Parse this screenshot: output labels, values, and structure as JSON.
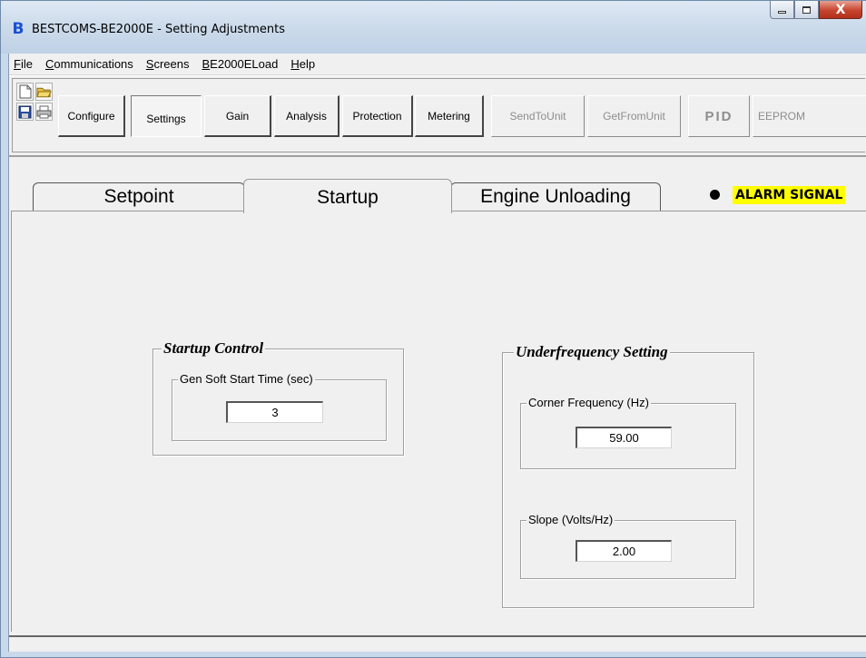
{
  "window": {
    "title": "BESTCOMS-BE2000E - Setting Adjustments",
    "app_icon": "B",
    "close_glyph": "X"
  },
  "menu": [
    "File",
    "Communications",
    "Screens",
    "BE2000ELoad",
    "Help"
  ],
  "toolbar": {
    "icons": [
      "new-file-icon",
      "open-folder-icon",
      "save-disk-icon",
      "print-icon"
    ],
    "buttons": {
      "configure": "Configure",
      "settings": "Settings",
      "gain": "Gain",
      "analysis": "Analysis",
      "protection": "Protection",
      "metering": "Metering",
      "send": "SendToUnit",
      "get": "GetFromUnit",
      "pid": "PID",
      "eeprom": "EEPROM"
    }
  },
  "tabs": {
    "setpoint": "Setpoint",
    "startup": "Startup",
    "engine": "Engine Unloading"
  },
  "alarm": {
    "label": "ALARM SIGNAL",
    "color": "#ffff00"
  },
  "startup_control": {
    "title": "Startup Control",
    "soft_start_label": "Gen Soft Start Time (sec)",
    "soft_start_value": "3"
  },
  "underfrequency": {
    "title": "Underfrequency Setting",
    "corner_label": "Corner Frequency (Hz)",
    "corner_value": "59.00",
    "slope_label": "Slope (Volts/Hz)",
    "slope_value": "2.00"
  }
}
